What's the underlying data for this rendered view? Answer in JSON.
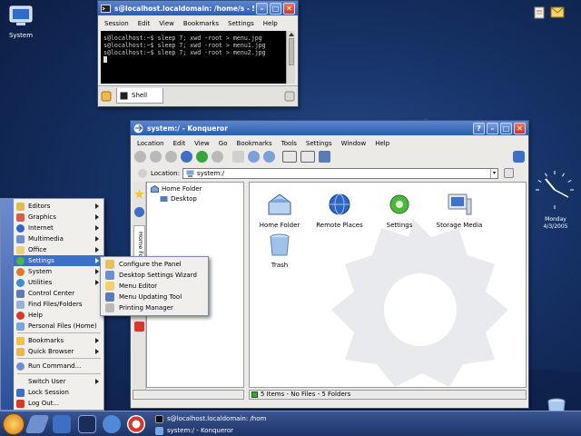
{
  "desktop": {
    "icons": [
      {
        "label": "System"
      }
    ],
    "clock": {
      "day": "Monday",
      "date": "4/3/2005"
    },
    "colors": {
      "background": "#163266",
      "panel": "#2a4478",
      "selection": "#3d6fc6"
    }
  },
  "shell_window": {
    "title": "s@localhost.localdomain: /home/s - Shell - Konqueror",
    "menu": [
      "Session",
      "Edit",
      "View",
      "Bookmarks",
      "Settings",
      "Help"
    ],
    "terminal_lines": [
      "s@localhost:~$ sleep 7; xwd -root > menu.jpg",
      "s@localhost:~$ sleep 7; xwd -root > menu1.jpg",
      "s@localhost:~$ sleep 7; xwd -root > menu2.jpg"
    ],
    "tab_label": "Shell"
  },
  "konqueror": {
    "title": "system:/ - Konqueror",
    "menu": [
      "Location",
      "Edit",
      "View",
      "Go",
      "Bookmarks",
      "Tools",
      "Settings",
      "Window",
      "Help"
    ],
    "location_label": "Location:",
    "location_value": "system:/",
    "side_tab": "Home Folder",
    "tree": [
      "Home Folder",
      "Desktop"
    ],
    "items": [
      {
        "label": "Home Folder",
        "icon": "home-folder-icon"
      },
      {
        "label": "Remote Places",
        "icon": "globe-icon"
      },
      {
        "label": "Settings",
        "icon": "gear-icon"
      },
      {
        "label": "Storage Media",
        "icon": "computer-icon"
      },
      {
        "label": "Trash",
        "icon": "trash-icon"
      }
    ],
    "status": "5 Items - No Files - 5 Folders"
  },
  "kmenu": {
    "items": [
      {
        "label": "Editors",
        "submenu": true
      },
      {
        "label": "Graphics",
        "submenu": true
      },
      {
        "label": "Internet",
        "submenu": true
      },
      {
        "label": "Multimedia",
        "submenu": true
      },
      {
        "label": "Office",
        "submenu": true
      },
      {
        "label": "Settings",
        "submenu": true,
        "selected": true
      },
      {
        "label": "System",
        "submenu": true
      },
      {
        "label": "Utilities",
        "submenu": true
      },
      {
        "label": "Control Center",
        "submenu": false
      },
      {
        "label": "Find Files/Folders",
        "submenu": false
      },
      {
        "label": "Help",
        "submenu": false
      },
      {
        "label": "Personal Files (Home)",
        "submenu": false
      },
      {
        "label": "Bookmarks",
        "submenu": true
      },
      {
        "label": "Quick Browser",
        "submenu": true
      },
      {
        "label": "Run Command...",
        "submenu": false
      },
      {
        "label": "Switch User",
        "submenu": true
      },
      {
        "label": "Lock Session",
        "submenu": false
      },
      {
        "label": "Log Out...",
        "submenu": false
      }
    ]
  },
  "settings_submenu": {
    "items": [
      {
        "label": "Configure the Panel"
      },
      {
        "label": "Desktop Settings Wizard"
      },
      {
        "label": "Menu Editor"
      },
      {
        "label": "Menu Updating Tool"
      },
      {
        "label": "Printing Manager"
      }
    ]
  },
  "taskbar": {
    "tasks": [
      {
        "label": "s@localhost.localdomain: /hom"
      },
      {
        "label": "system:/ - Konqueror"
      }
    ]
  }
}
